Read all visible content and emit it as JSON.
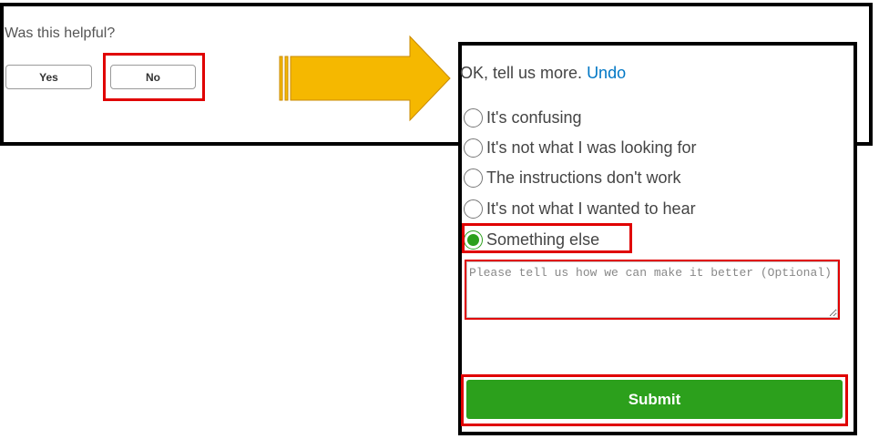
{
  "feedback": {
    "question": "Was this helpful?",
    "yes_label": "Yes",
    "no_label": "No"
  },
  "followup": {
    "prompt": "OK, tell us more.",
    "undo_label": "Undo",
    "options": [
      {
        "label": "It's confusing",
        "selected": false
      },
      {
        "label": "It's not what I was looking for",
        "selected": false
      },
      {
        "label": "The instructions don't work",
        "selected": false
      },
      {
        "label": "It's not what I wanted to hear",
        "selected": false
      },
      {
        "label": "Something else",
        "selected": true
      }
    ],
    "comment_placeholder": "Please tell us how we can make it better (Optional)",
    "comment_value": "",
    "submit_label": "Submit"
  },
  "colors": {
    "highlight": "#e00000",
    "arrow": "#f5b800",
    "submit": "#2ca01c",
    "link": "#0077c5"
  }
}
